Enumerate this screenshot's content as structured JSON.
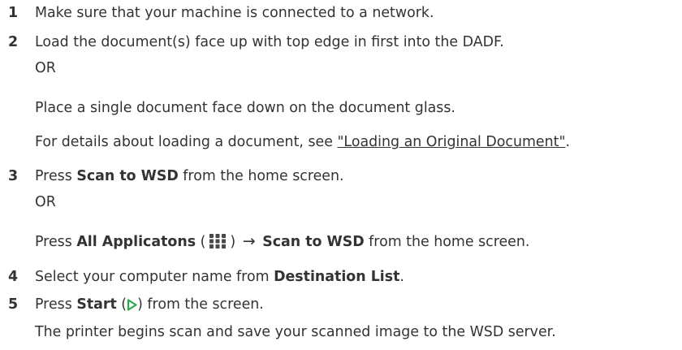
{
  "steps": [
    {
      "num": "1",
      "text": "Make sure that your machine is connected to a network."
    },
    {
      "num": "2",
      "text": "Load the document(s) face up with top edge in first into the DADF.",
      "or": "OR",
      "alt": "Place a single document face down on the document glass.",
      "details_prefix": "For details about loading a document, see ",
      "details_link": "\"Loading an Original Document\"",
      "details_suffix": "."
    },
    {
      "num": "3",
      "press": "Press ",
      "bold1": "Scan to WSD",
      "rest1": " from the home screen.",
      "or": "OR",
      "bold_all": "All Applicatons",
      "open_paren": " (",
      "close_paren": ")",
      "arrow": "→",
      "bold2": "Scan to WSD",
      "rest2": " from the home screen."
    },
    {
      "num": "4",
      "prefix": "Select your computer name from ",
      "bold": "Destination List",
      "suffix": "."
    },
    {
      "num": "5",
      "press": "Press ",
      "bold": "Start",
      "open_paren": " (",
      "close_paren": ")",
      "suffix": " from the screen.",
      "result": "The printer begins scan and save your scanned image to the WSD server."
    }
  ],
  "icons": {
    "apps": "apps-grid-icon",
    "start": "start-play-icon"
  },
  "colors": {
    "text": "#333333",
    "icon": "#4a4a4a",
    "start_icon": "#2aa84a"
  }
}
